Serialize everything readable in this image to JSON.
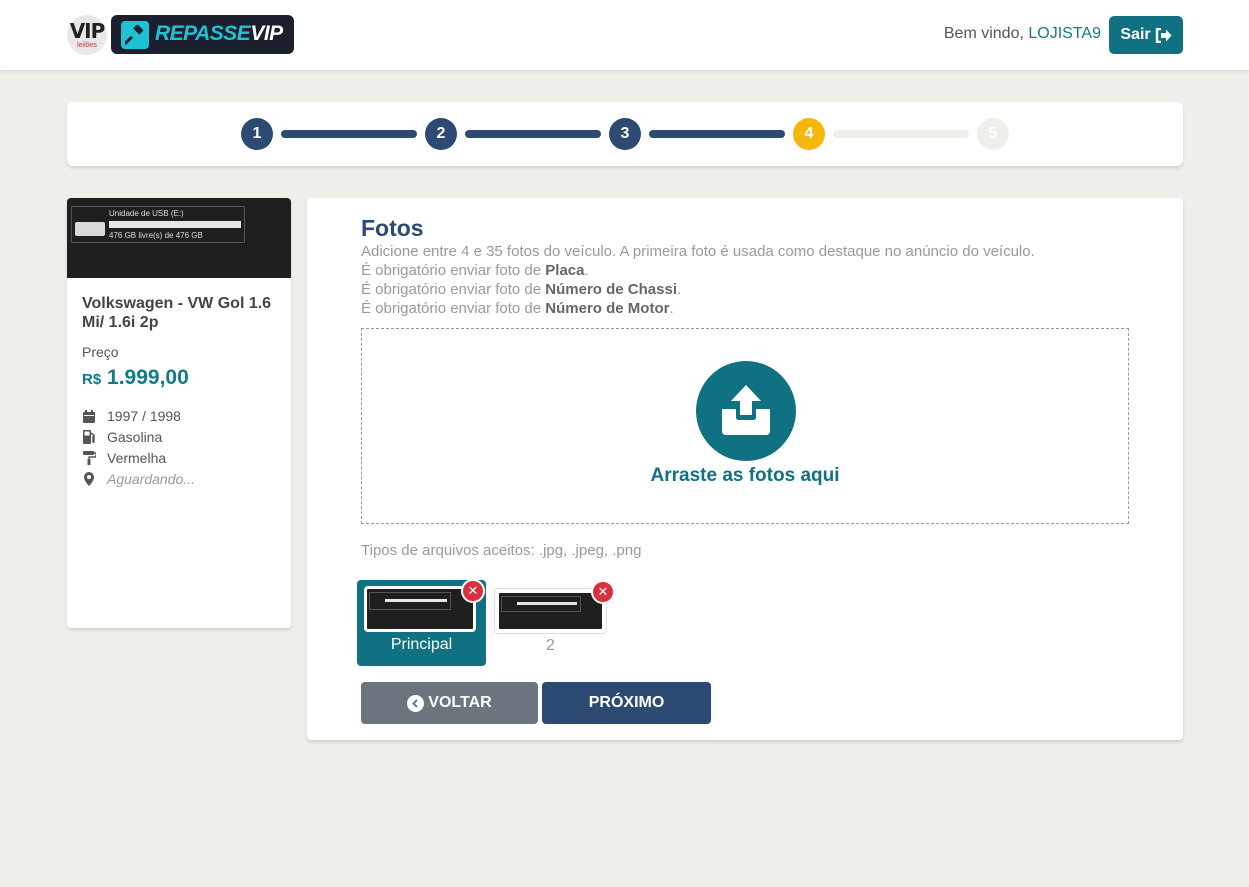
{
  "header": {
    "logo_vip": "VIP",
    "logo_vip_sub": "leilões",
    "logo_brand_a": "REPASSE",
    "logo_brand_b": "VIP",
    "welcome": "Bem vindo,",
    "username": "LOJISTA9",
    "logout_label": "Sair"
  },
  "stepper": {
    "steps": [
      "1",
      "2",
      "3",
      "4",
      "5"
    ],
    "current_step": 4,
    "colors": {
      "done": "#2d4a73",
      "active": "#f5b80a",
      "todo": "#efefea"
    }
  },
  "vehicle": {
    "thumb": {
      "drive_title": "Unidade de USB (E:)",
      "drive_free": "476 GB livre(s) de 476 GB"
    },
    "title": "Volkswagen - VW Gol 1.6 Mi/ 1.6i 2p",
    "price_label": "Preço",
    "currency": "R$",
    "price": "1.999,00",
    "specs": [
      {
        "icon": "calendar-icon",
        "text": "1997 / 1998"
      },
      {
        "icon": "gas-pump-icon",
        "text": "Gasolina"
      },
      {
        "icon": "paint-roller-icon",
        "text": "Vermelha"
      },
      {
        "icon": "map-marker-icon",
        "text": "Aguardando..."
      }
    ]
  },
  "photos": {
    "title": "Fotos",
    "description": "Adicione entre 4 e 35 fotos do veículo. A primeira foto é usada como destaque no anúncio do veículo.",
    "required_prefix": "É obrigatório enviar foto de",
    "required": [
      "Placa",
      "Número de Chassi",
      "Número de Motor"
    ],
    "dropzone_text": "Arraste as fotos aqui",
    "accepted_types": "Tipos de arquivos aceitos: .jpg, .jpeg, .png",
    "thumbnails": [
      {
        "label": "Principal",
        "main": true
      },
      {
        "label": "2",
        "main": false
      }
    ],
    "delete_glyph": "✕"
  },
  "actions": {
    "back_label": "VOLTAR",
    "next_label": "PRÓXIMO"
  },
  "colors": {
    "teal": "#0f7182",
    "navy": "#2d4a73",
    "yellow": "#f5b80a",
    "danger": "#d9303f",
    "gray_button": "#6c757d"
  }
}
